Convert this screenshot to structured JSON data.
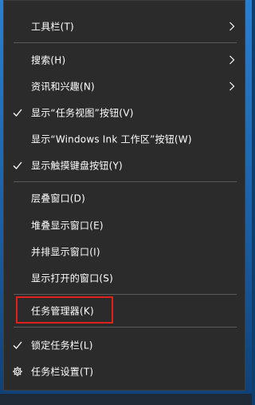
{
  "context_menu": {
    "items": [
      {
        "label": "工具栏(T)",
        "checked": false,
        "submenu": true,
        "icon": ""
      },
      {
        "label": "搜索(H)",
        "checked": false,
        "submenu": true,
        "icon": ""
      },
      {
        "label": "资讯和兴趣(N)",
        "checked": false,
        "submenu": true,
        "icon": ""
      },
      {
        "label": "显示“任务视图”按钮(V)",
        "checked": true,
        "submenu": false,
        "icon": ""
      },
      {
        "label": "显示“Windows Ink 工作区”按钮(W)",
        "checked": false,
        "submenu": false,
        "icon": ""
      },
      {
        "label": "显示触摸键盘按钮(Y)",
        "checked": true,
        "submenu": false,
        "icon": ""
      },
      {
        "label": "层叠窗口(D)",
        "checked": false,
        "submenu": false,
        "icon": ""
      },
      {
        "label": "堆叠显示窗口(E)",
        "checked": false,
        "submenu": false,
        "icon": ""
      },
      {
        "label": "并排显示窗口(I)",
        "checked": false,
        "submenu": false,
        "icon": ""
      },
      {
        "label": "显示打开的窗口(S)",
        "checked": false,
        "submenu": false,
        "icon": ""
      },
      {
        "label": "任务管理器(K)",
        "checked": false,
        "submenu": false,
        "icon": "",
        "highlighted": true
      },
      {
        "label": "锁定任务栏(L)",
        "checked": true,
        "submenu": false,
        "icon": ""
      },
      {
        "label": "任务栏设置(T)",
        "checked": false,
        "submenu": false,
        "icon": "gear-icon"
      }
    ]
  },
  "colors": {
    "menu_background": "#2b2b2b",
    "text": "#ffffff",
    "separator": "#5a5a5a",
    "highlight_border": "#e0201a"
  }
}
